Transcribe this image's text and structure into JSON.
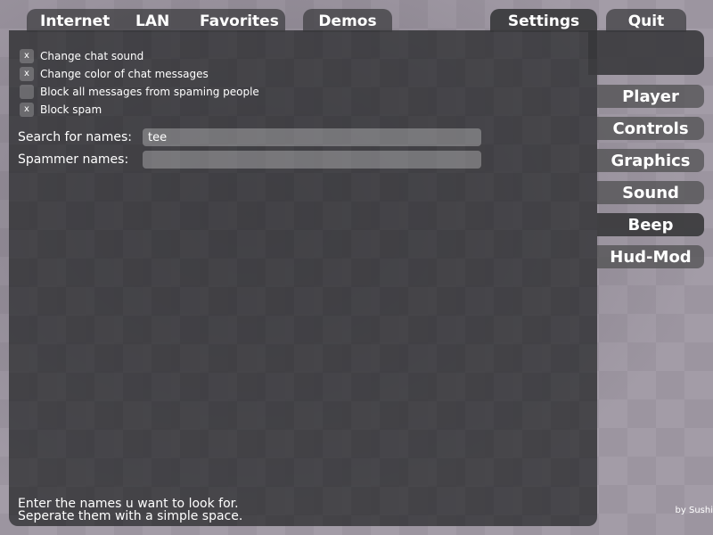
{
  "tabs": {
    "internet": "Internet",
    "lan": "LAN",
    "favorites": "Favorites",
    "demos": "Demos",
    "settings": "Settings",
    "quit": "Quit"
  },
  "checkboxes": [
    {
      "label": "Change chat sound",
      "mark": "x",
      "checked": true
    },
    {
      "label": "Change color of chat messages",
      "mark": "x",
      "checked": true
    },
    {
      "label": "Block all messages from spaming people",
      "mark": "",
      "checked": false
    },
    {
      "label": "Block spam",
      "mark": "x",
      "checked": true
    }
  ],
  "fields": {
    "search_label": "Search for names:",
    "search_value": "tee",
    "spammer_label": "Spammer names:",
    "spammer_value": ""
  },
  "hint": {
    "line1": "Enter the names u want to look for.",
    "line2": "Seperate them with a simple space."
  },
  "sidebar": {
    "items": [
      {
        "label": "Player"
      },
      {
        "label": "Controls"
      },
      {
        "label": "Graphics"
      },
      {
        "label": "Sound"
      },
      {
        "label": "Beep",
        "active": true
      },
      {
        "label": "Hud-Mod"
      }
    ]
  },
  "credit": "by Sushi"
}
